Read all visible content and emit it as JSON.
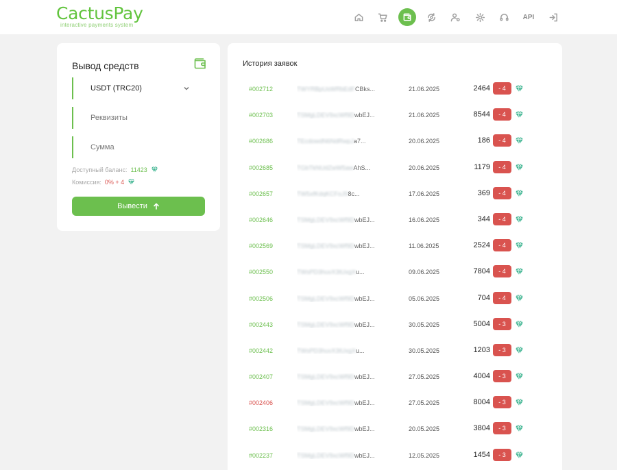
{
  "header": {
    "logo_title": "CactusPay",
    "logo_subtitle": "interactive payments system",
    "nav": [
      {
        "icon": "home-icon",
        "label": ""
      },
      {
        "icon": "cart-icon",
        "label": ""
      },
      {
        "icon": "wallet-icon",
        "label": "",
        "active": true
      },
      {
        "icon": "coin-exchange-icon",
        "label": ""
      },
      {
        "icon": "user-settings-icon",
        "label": ""
      },
      {
        "icon": "gear-icon",
        "label": ""
      },
      {
        "icon": "headset-icon",
        "label": ""
      },
      {
        "icon": "api-text",
        "label": "API"
      },
      {
        "icon": "logout-icon",
        "label": ""
      }
    ]
  },
  "withdraw": {
    "title": "Вывод средств",
    "currency": "USDT (TRC20)",
    "requisites_placeholder": "Реквизиты",
    "amount_placeholder": "Сумма",
    "balance_label": "Доступный баланс:",
    "balance_value": "11423",
    "commission_label": "Комиссия:",
    "commission_value": "0% + 4",
    "button_label": "Вывести"
  },
  "history": {
    "title": "История заявок",
    "rows": [
      {
        "id": "#002712",
        "addr_blur": "TWYRBpUsWRbEdF",
        "addr_tail": "CBks...",
        "date": "21.06.2025",
        "amount": "2464",
        "fee": "- 4",
        "status": "ok"
      },
      {
        "id": "#002703",
        "addr_blur": "TSMgLDEV9xcWf9D",
        "addr_tail": "wbEJ...",
        "date": "21.06.2025",
        "amount": "8544",
        "fee": "- 4",
        "status": "ok"
      },
      {
        "id": "#002686",
        "addr_blur": "TEcdowdN6NdRwpJ",
        "addr_tail": "a7...",
        "date": "20.06.2025",
        "amount": "186",
        "fee": "- 4",
        "status": "ok"
      },
      {
        "id": "#002685",
        "addr_blur": "TGbTkNUdZwW5aw",
        "addr_tail": "AhS...",
        "date": "20.06.2025",
        "amount": "1179",
        "fee": "- 4",
        "status": "ok"
      },
      {
        "id": "#002657",
        "addr_blur": "TW5xfKdqKCFoJ9",
        "addr_tail": "8c...",
        "date": "17.06.2025",
        "amount": "369",
        "fee": "- 4",
        "status": "ok"
      },
      {
        "id": "#002646",
        "addr_blur": "TSMgLDEV9xcWf9D",
        "addr_tail": "wbEJ...",
        "date": "16.06.2025",
        "amount": "344",
        "fee": "- 4",
        "status": "ok"
      },
      {
        "id": "#002569",
        "addr_blur": "TSMgLDEV9xcWf9D",
        "addr_tail": "wbEJ...",
        "date": "11.06.2025",
        "amount": "2524",
        "fee": "- 4",
        "status": "ok"
      },
      {
        "id": "#002550",
        "addr_blur": "TWsPD3huvX3tUxgX",
        "addr_tail": "u...",
        "date": "09.06.2025",
        "amount": "7804",
        "fee": "- 4",
        "status": "ok"
      },
      {
        "id": "#002506",
        "addr_blur": "TSMgLDEV9xcWf9D",
        "addr_tail": "wbEJ...",
        "date": "05.06.2025",
        "amount": "704",
        "fee": "- 4",
        "status": "ok"
      },
      {
        "id": "#002443",
        "addr_blur": "TSMgLDEV9xcWf9D",
        "addr_tail": "wbEJ...",
        "date": "30.05.2025",
        "amount": "5004",
        "fee": "- 3",
        "status": "ok"
      },
      {
        "id": "#002442",
        "addr_blur": "TWsPD3huvX3tUxgX",
        "addr_tail": "u...",
        "date": "30.05.2025",
        "amount": "1203",
        "fee": "- 3",
        "status": "ok"
      },
      {
        "id": "#002407",
        "addr_blur": "TSMgLDEV9xcWf9D",
        "addr_tail": "wbEJ...",
        "date": "27.05.2025",
        "amount": "4004",
        "fee": "- 3",
        "status": "ok"
      },
      {
        "id": "#002406",
        "addr_blur": "TSMgLDEV9xcWf9D",
        "addr_tail": "wbEJ...",
        "date": "27.05.2025",
        "amount": "8004",
        "fee": "- 3",
        "status": "rejected"
      },
      {
        "id": "#002316",
        "addr_blur": "TSMgLDEV9xcWf9D",
        "addr_tail": "wbEJ...",
        "date": "20.05.2025",
        "amount": "3804",
        "fee": "- 3",
        "status": "ok"
      },
      {
        "id": "#002237",
        "addr_blur": "TSMgLDEV9xcWf9D",
        "addr_tail": "wbEJ...",
        "date": "12.05.2025",
        "amount": "1454",
        "fee": "- 3",
        "status": "ok"
      }
    ]
  },
  "colors": {
    "brand_green": "#6cbf4e",
    "fee_red": "#d9534f",
    "gem_teal": "#3bb38f"
  }
}
